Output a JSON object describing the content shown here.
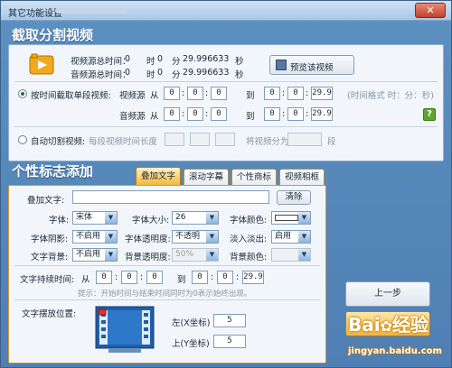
{
  "window": {
    "title": "其它功能设置",
    "close_label": "✕"
  },
  "cut": {
    "section_title": "截取分割视频",
    "video_total_label": "视频源总时间：",
    "video_total_h": "0",
    "video_total_h_unit": "时",
    "video_total_m": "0",
    "video_total_m_unit": "分",
    "video_total_s": "29.996633",
    "video_total_s_unit": "秒",
    "audio_total_label": "音频源总时间：",
    "audio_total_h": "0",
    "audio_total_h_unit": "时",
    "audio_total_m": "0",
    "audio_total_m_unit": "分",
    "audio_total_s": "29.996633",
    "audio_total_s_unit": "秒",
    "preview_button": "预览该视频",
    "radio_by_time_label": "按时间截取单段视频:",
    "video_src_label": "视频源",
    "audio_src_label": "音频源",
    "from_label": "从",
    "to_label": "到",
    "video_from": [
      "0",
      "0",
      "0"
    ],
    "video_to": [
      "0",
      "0",
      "29.9"
    ],
    "audio_from": [
      "0",
      "0",
      "0"
    ],
    "audio_to": [
      "0",
      "0",
      "29.9"
    ],
    "time_format_hint": "(时间格式 时：分：秒)",
    "help_label": "?",
    "radio_auto_label": "自动切割视频:",
    "segment_length_label": "每段视频时间长度",
    "split_into_label": "将视频分为",
    "segment_unit_label": "段"
  },
  "logo": {
    "section_title": "个性标志添加",
    "tabs": [
      "叠加文字",
      "滚动字幕",
      "个性商标",
      "视频相框"
    ],
    "overlay_text_label": "叠加文字:",
    "overlay_text_value": "",
    "clear_button": "清除",
    "font_label": "字体:",
    "font_value": "宋体",
    "font_size_label": "字体大小:",
    "font_size_value": "26",
    "font_color_label": "字体颜色:",
    "shadow_label": "字体阴影:",
    "shadow_value": "不启用",
    "transparency_label": "字体透明度:",
    "transparency_value": "不透明",
    "fade_label": "淡入淡出:",
    "fade_value": "启用",
    "text_bg_label": "文字背景:",
    "text_bg_value": "不启用",
    "bg_transparency_label": "背景透明度:",
    "bg_transparency_value": "50%",
    "bg_color_label": "背景颜色:",
    "duration_label": "文字持续时间:",
    "from_label": "从",
    "to_label": "到",
    "duration_from": [
      "0",
      "0",
      "0"
    ],
    "duration_to": [
      "0",
      "0",
      "29.9"
    ],
    "duration_hint": "提示：开始时间与结束时间同时为0表示始终出现。",
    "position_label": "文字摆放位置:",
    "left_label": "左(X坐标)",
    "left_value": "5",
    "top_label": "上(Y坐标)",
    "top_value": "5"
  },
  "buttons": {
    "prev_step": "上一步"
  },
  "watermark": {
    "brand": "Bai",
    "brand2": "经验",
    "site": "jingyan.baidu.com"
  }
}
